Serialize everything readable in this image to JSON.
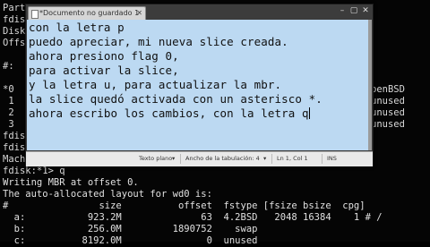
{
  "terminal": {
    "left_fragments": [
      "Part",
      "fdis",
      "Disk",
      "Offs",
      "#:",
      "*0",
      " 1",
      " 2",
      " 3",
      "fdis",
      "fdis",
      "Mach",
      "fdisk:*1> q"
    ],
    "right_fragments": [
      "",
      "",
      "",
      "",
      "",
      "penBSD",
      "unused",
      "unused",
      "unused"
    ],
    "lines_bottom": [
      "Writing MBR at offset 0.",
      "The auto-allocated layout for wd0 is:",
      "#                size          offset  fstype [fsize bsize  cpg]",
      "  a:           923.2M              63  4.2BSD   2048 16384    1 # /",
      "  b:           256.0M         1890752    swap",
      "  c:          8192.0M               0  unused"
    ]
  },
  "editor": {
    "tab_title": "*Documento no guardado 1",
    "lines": [
      "con la letra p",
      "puedo apreciar, mi nueva slice creada.",
      "ahora presiono flag 0,",
      "para activar la slice,",
      "y la letra u, para actualizar la mbr.",
      "la slice quedó activada con un asterisco *.",
      "ahora escribo los cambios, con la letra q"
    ],
    "status": {
      "mode": "Texto plano",
      "tab_width": "Ancho de la tabulación: 4",
      "position": "Ln 1, Col 1",
      "insert": "INS"
    }
  },
  "colors": {
    "editor_bg": "#bcd9f2",
    "terminal_bg": "#050505",
    "terminal_fg": "#d8d8d8"
  }
}
